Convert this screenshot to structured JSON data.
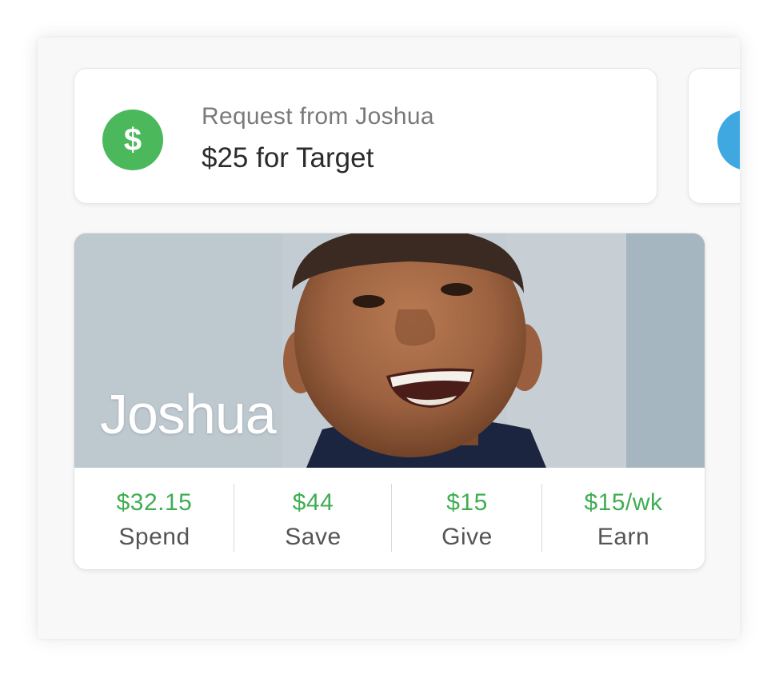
{
  "request": {
    "subtitle": "Request from Joshua",
    "title": "$25 for Target",
    "icon": "dollar-sign-icon",
    "icon_glyph": "$",
    "icon_color": "#4cb85c"
  },
  "next_card": {
    "icon_color": "#3fa8e0"
  },
  "profile": {
    "name": "Joshua",
    "stats": [
      {
        "value": "$32.15",
        "label": "Spend"
      },
      {
        "value": "$44",
        "label": "Save"
      },
      {
        "value": "$15",
        "label": "Give"
      },
      {
        "value": "$15/wk",
        "label": "Earn"
      }
    ]
  },
  "colors": {
    "accent_green": "#3fae52",
    "label_gray": "#555555"
  }
}
